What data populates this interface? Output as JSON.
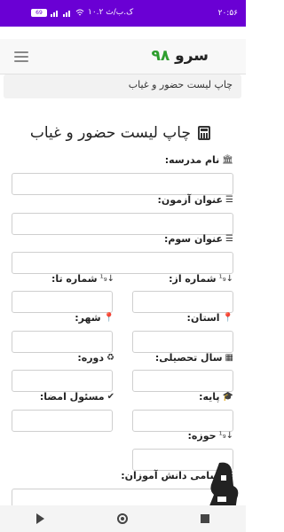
{
  "status_bar": {
    "time": "۲۰:۵۶",
    "speed": "۱۰.۲ ک.ب/ث",
    "battery": "69"
  },
  "header": {
    "brand_text": "سرو",
    "brand_number": "۹۸"
  },
  "breadcrumb": "چاپ لیست حضور و غیاب",
  "page_title": "چاپ لیست حضور و غیاب",
  "fields": {
    "school_name": "نام مدرسه:",
    "exam_title": "عنوان آزمون:",
    "third_title": "عنوان سوم:",
    "number_from": "شماره از:",
    "number_to": "شماره تا:",
    "province": "استان:",
    "city": "شهر:",
    "school_year": "سال تحصیلی:",
    "period": "دوره:",
    "grade": "پایه:",
    "signatory": "مسئول امضا:",
    "district": "حوزه:",
    "student_names": "اسامی دانش آموزان:"
  },
  "colors": {
    "status_bar": "#6a00d4",
    "brand_number": "#2e9e2e"
  }
}
